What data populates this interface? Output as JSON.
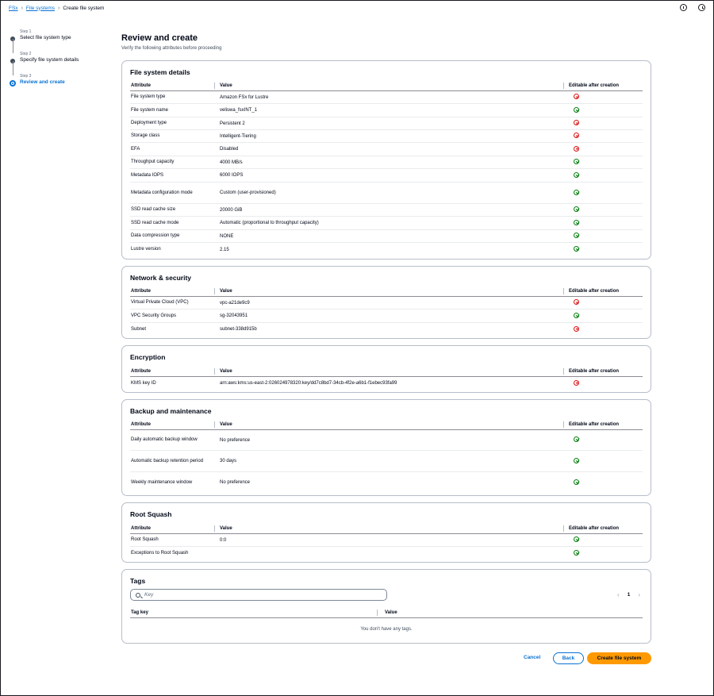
{
  "breadcrumb": [
    "FSx",
    "File systems",
    "Create file system"
  ],
  "steps": [
    {
      "num": "Step 1",
      "label": "Select file system type"
    },
    {
      "num": "Step 2",
      "label": "Specify file system details"
    },
    {
      "num": "Step 3",
      "label": "Review and create"
    }
  ],
  "header": {
    "title": "Review and create",
    "subtitle": "Verify the following attributes before proceeding"
  },
  "columns": {
    "attribute": "Attribute",
    "value": "Value",
    "editable": "Editable after creation"
  },
  "sections": {
    "fs": {
      "title": "File system details",
      "rows": [
        {
          "attr": "File system type",
          "value": "Amazon FSx for Lustre",
          "editable": false
        },
        {
          "attr": "File system name",
          "value": "veliswa_fsxINT_1",
          "editable": true
        },
        {
          "attr": "Deployment type",
          "value": "Persistent 2",
          "editable": false
        },
        {
          "attr": "Storage class",
          "value": "Intelligent-Tiering",
          "editable": false
        },
        {
          "attr": "EFA",
          "value": "Disabled",
          "editable": false
        },
        {
          "attr": "Throughput capacity",
          "value": "4000 MB/s",
          "editable": true
        },
        {
          "attr": "Metadata IOPS",
          "value": "6000 IOPS",
          "editable": true
        },
        {
          "attr": "Metadata configuration mode",
          "value": "Custom (user-provisioned)",
          "editable": true
        },
        {
          "attr": "SSD read cache size",
          "value": "20000 GiB",
          "editable": true
        },
        {
          "attr": "SSD read cache mode",
          "value": "Automatic (proportional to throughput capacity)",
          "editable": true
        },
        {
          "attr": "Data compression type",
          "value": "NONE",
          "editable": true
        },
        {
          "attr": "Lustre version",
          "value": "2.15",
          "editable": true
        }
      ]
    },
    "network": {
      "title": "Network & security",
      "rows": [
        {
          "attr": "Virtual Private Cloud (VPC)",
          "value": "vpc-a21de9c9",
          "editable": false
        },
        {
          "attr": "VPC Security Groups",
          "value": "sg-32043951",
          "editable": true
        },
        {
          "attr": "Subnet",
          "value": "subnet-338d915b",
          "editable": false
        }
      ]
    },
    "encryption": {
      "title": "Encryption",
      "rows": [
        {
          "attr": "KMS key ID",
          "value": "arn:aws:kms:us-east-2:026024978320:key/dd7c8bd7-34cb-4f2e-a6b1-f1ebec93fa99",
          "editable": false
        }
      ]
    },
    "backup": {
      "title": "Backup and maintenance",
      "rows": [
        {
          "attr": "Daily automatic backup window",
          "value": "No preference",
          "editable": true
        },
        {
          "attr": "Automatic backup retention period",
          "value": "30 days",
          "editable": true
        },
        {
          "attr": "Weekly maintenance window",
          "value": "No preference",
          "editable": true
        }
      ]
    },
    "squash": {
      "title": "Root Squash",
      "rows": [
        {
          "attr": "Root Squash",
          "value": "0:0",
          "editable": true
        },
        {
          "attr": "Exceptions to Root Squash",
          "value": "",
          "editable": true
        }
      ]
    }
  },
  "tags": {
    "title": "Tags",
    "search_placeholder": "Key",
    "page": "1",
    "col_key": "Tag key",
    "col_value": "Value",
    "empty": "You don't have any tags."
  },
  "footer": {
    "cancel": "Cancel",
    "back": "Back",
    "create": "Create file system"
  },
  "colors": {
    "accent": "#0972d3",
    "primary_button": "#ff9900",
    "error": "#d91515",
    "success": "#037f0c"
  }
}
